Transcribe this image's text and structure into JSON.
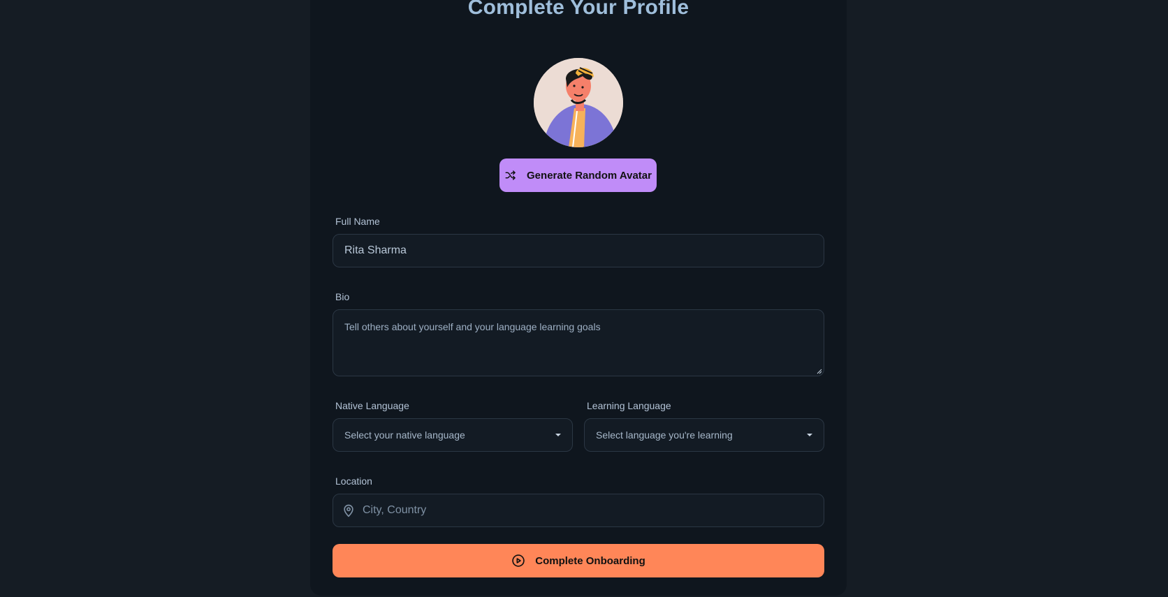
{
  "title": "Complete Your Profile",
  "avatar": {
    "icon": "cartoon-avatar-image"
  },
  "generate_button": {
    "label": "Generate Random Avatar",
    "icon": "shuffle-icon"
  },
  "full_name": {
    "label": "Full Name",
    "value": "Rita Sharma"
  },
  "bio": {
    "label": "Bio",
    "placeholder": "Tell others about yourself and your language learning goals"
  },
  "native_language": {
    "label": "Native Language",
    "selected": "Select your native language"
  },
  "learning_language": {
    "label": "Learning Language",
    "selected": "Select language you're learning"
  },
  "location": {
    "label": "Location",
    "placeholder": "City, Country",
    "icon": "map-pin-icon"
  },
  "complete_button": {
    "label": "Complete Onboarding",
    "icon": "play-circle-icon"
  },
  "colors": {
    "accent_purple": "#c08cf8",
    "accent_orange": "#ff8658",
    "title": "#9fbedb"
  }
}
